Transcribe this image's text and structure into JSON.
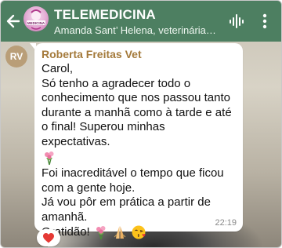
{
  "header": {
    "title": "TELEMEDICINA",
    "subtitle": "Amanda Sant’ Helena, veterinária de a…",
    "avatar_text": "MEDICINA",
    "colors": {
      "bar": "#4d7f61",
      "text": "#ffffff"
    }
  },
  "message": {
    "avatar_initials": "RV",
    "sender": "Roberta Freitas Vet",
    "lines": [
      "Carol,",
      "Só tenho a agradecer todo o conhecimento que nos passou tanto durante a manhã como à tarde e até o final! Superou minhas expectativas.",
      "Foi inacreditável o tempo que ficou com a gente hoje.",
      "Já vou pôr em prática a partir de amanhã.",
      "Gratidão!"
    ],
    "emojis": [
      "bouquet-emoji",
      "bouquet-emoji",
      "folded-hands-emoji",
      "kissing-face-emoji"
    ],
    "time": "22:19",
    "reaction": "heart-icon",
    "colors": {
      "sender_name": "#a47a3b",
      "bubble": "#ffffff",
      "avatar": "#b99e78",
      "heart": "#e53935"
    }
  }
}
